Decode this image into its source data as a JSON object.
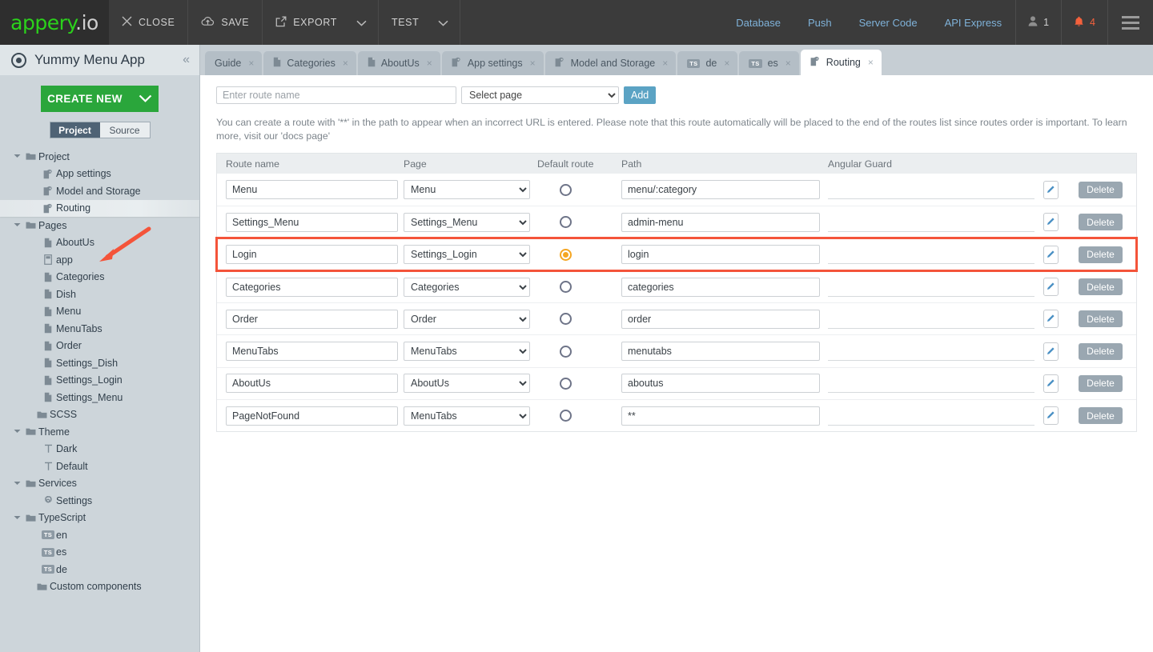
{
  "topbar": {
    "logo": "appery",
    "logo_suffix": ".io",
    "buttons": [
      {
        "label": "CLOSE",
        "icon": "close-icon"
      },
      {
        "label": "SAVE",
        "icon": "cloud-upload-icon"
      },
      {
        "label": "EXPORT",
        "icon": "export-icon",
        "caret": true
      },
      {
        "label": "TEST",
        "icon": "",
        "caret": true
      }
    ],
    "links": [
      "Database",
      "Push",
      "Server Code",
      "API Express"
    ],
    "user_count": "1",
    "notification_count": "4",
    "menu_icon": "hamburger-icon"
  },
  "sidebar": {
    "app_title": "Yummy Menu App",
    "collapse_icon": "chevron-double-left-icon",
    "create_new_label": "CREATE NEW",
    "toggle": {
      "active": "Project",
      "inactive": "Source"
    },
    "tree": [
      {
        "label": "Project",
        "icon": "folder-icon",
        "depth": 0,
        "twisty": "down",
        "highlight": false
      },
      {
        "label": "App settings",
        "icon": "settings-page-icon",
        "depth": 1,
        "twisty": "",
        "highlight": false
      },
      {
        "label": "Model and Storage",
        "icon": "settings-page-icon",
        "depth": 1,
        "twisty": "",
        "highlight": false
      },
      {
        "label": "Routing",
        "icon": "settings-page-icon",
        "depth": 1,
        "twisty": "",
        "highlight": true
      },
      {
        "label": "Pages",
        "icon": "folder-icon",
        "depth": 0,
        "twisty": "down",
        "highlight": false
      },
      {
        "label": "AboutUs",
        "icon": "page-icon",
        "depth": 1,
        "twisty": "",
        "highlight": false
      },
      {
        "label": "app",
        "icon": "page-alt-icon",
        "depth": 1,
        "twisty": "",
        "highlight": false
      },
      {
        "label": "Categories",
        "icon": "page-icon",
        "depth": 1,
        "twisty": "",
        "highlight": false
      },
      {
        "label": "Dish",
        "icon": "page-icon",
        "depth": 1,
        "twisty": "",
        "highlight": false
      },
      {
        "label": "Menu",
        "icon": "page-icon",
        "depth": 1,
        "twisty": "",
        "highlight": false
      },
      {
        "label": "MenuTabs",
        "icon": "page-icon",
        "depth": 1,
        "twisty": "",
        "highlight": false
      },
      {
        "label": "Order",
        "icon": "page-icon",
        "depth": 1,
        "twisty": "",
        "highlight": false
      },
      {
        "label": "Settings_Dish",
        "icon": "page-icon",
        "depth": 1,
        "twisty": "",
        "highlight": false
      },
      {
        "label": "Settings_Login",
        "icon": "page-icon",
        "depth": 1,
        "twisty": "",
        "highlight": false
      },
      {
        "label": "Settings_Menu",
        "icon": "page-icon",
        "depth": 1,
        "twisty": "",
        "highlight": false
      },
      {
        "label": "SCSS",
        "icon": "folder-icon",
        "depth": 0.5,
        "twisty": "",
        "highlight": false
      },
      {
        "label": "Theme",
        "icon": "folder-icon",
        "depth": 0,
        "twisty": "down",
        "highlight": false
      },
      {
        "label": "Dark",
        "icon": "theme-icon",
        "depth": 1,
        "twisty": "",
        "highlight": false
      },
      {
        "label": "Default",
        "icon": "theme-icon",
        "depth": 1,
        "twisty": "",
        "highlight": false
      },
      {
        "label": "Services",
        "icon": "folder-icon",
        "depth": 0,
        "twisty": "down",
        "highlight": false
      },
      {
        "label": "Settings",
        "icon": "gear-icon",
        "depth": 1,
        "twisty": "",
        "highlight": false
      },
      {
        "label": "TypeScript",
        "icon": "folder-icon",
        "depth": 0,
        "twisty": "down",
        "highlight": false
      },
      {
        "label": "en",
        "icon": "ts-icon",
        "depth": 1,
        "twisty": "",
        "highlight": false
      },
      {
        "label": "es",
        "icon": "ts-icon",
        "depth": 1,
        "twisty": "",
        "highlight": false
      },
      {
        "label": "de",
        "icon": "ts-icon",
        "depth": 1,
        "twisty": "",
        "highlight": false
      },
      {
        "label": "Custom components",
        "icon": "folder-icon",
        "depth": 0.5,
        "twisty": "",
        "highlight": false
      }
    ]
  },
  "tabs": [
    {
      "label": "Guide",
      "icon": "",
      "active": false
    },
    {
      "label": "Categories",
      "icon": "page-icon",
      "active": false
    },
    {
      "label": "AboutUs",
      "icon": "page-icon",
      "active": false
    },
    {
      "label": "App settings",
      "icon": "settings-page-icon",
      "active": false
    },
    {
      "label": "Model and Storage",
      "icon": "settings-page-icon",
      "active": false
    },
    {
      "label": "de",
      "icon": "ts-icon",
      "active": false
    },
    {
      "label": "es",
      "icon": "ts-icon",
      "active": false
    },
    {
      "label": "Routing",
      "icon": "settings-page-icon",
      "active": true
    }
  ],
  "main": {
    "route_name_placeholder": "Enter route name",
    "route_name_value": "",
    "page_select_value": "Select page",
    "add_button_label": "Add",
    "hint": "You can create a route with '**' in the path to appear when an incorrect URL is entered. Please note that this route automatically will be placed to the end of the routes list since routes order is important. To learn more, visit our 'docs page'",
    "table": {
      "headers": [
        "Route name",
        "Page",
        "Default route",
        "Path",
        "Angular Guard"
      ],
      "delete_label": "Delete",
      "edit_icon": "pencil-icon",
      "rows": [
        {
          "name": "Menu",
          "page": "Menu",
          "default": false,
          "path": "menu/:category",
          "guard": "",
          "selected": false
        },
        {
          "name": "Settings_Menu",
          "page": "Settings_Menu",
          "default": false,
          "path": "admin-menu",
          "guard": "",
          "selected": false
        },
        {
          "name": "Login",
          "page": "Settings_Login",
          "default": true,
          "path": "login",
          "guard": "",
          "selected": true
        },
        {
          "name": "Categories",
          "page": "Categories",
          "default": false,
          "path": "categories",
          "guard": "",
          "selected": false
        },
        {
          "name": "Order",
          "page": "Order",
          "default": false,
          "path": "order",
          "guard": "",
          "selected": false
        },
        {
          "name": "MenuTabs",
          "page": "MenuTabs",
          "default": false,
          "path": "menutabs",
          "guard": "",
          "selected": false
        },
        {
          "name": "AboutUs",
          "page": "AboutUs",
          "default": false,
          "path": "aboutus",
          "guard": "",
          "selected": false
        },
        {
          "name": "PageNotFound",
          "page": "MenuTabs",
          "default": false,
          "path": "**",
          "guard": "",
          "selected": false
        }
      ]
    }
  },
  "colors": {
    "brand_green": "#2bd21b",
    "accent_blue": "#5ba3c4",
    "highlight_red": "#f4543a",
    "radio_on": "#f5a623",
    "sidebar_bg": "#cdd5da",
    "topbar_bg": "#3b3b3b"
  }
}
